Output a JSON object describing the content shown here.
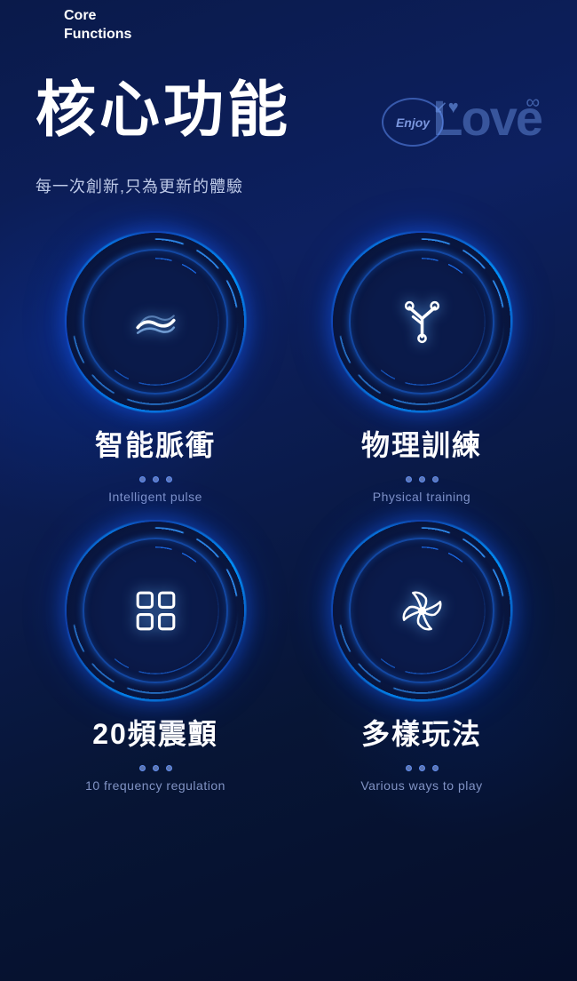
{
  "header": {
    "core_label": "Core",
    "functions_label": "Functions"
  },
  "hero": {
    "main_title": "核心功能",
    "subtitle": "每一次創新,只為更新的體驗",
    "enjoy_love": {
      "enjoy": "Enjoy",
      "love": "Love",
      "infinity": "∞"
    }
  },
  "features": [
    {
      "id": "intelligent-pulse",
      "name_zh": "智能脈衝",
      "name_en": "Intelligent pulse",
      "icon": "pulse",
      "dots": 3
    },
    {
      "id": "physical-training",
      "name_zh": "物理訓練",
      "name_en": "Physical training",
      "icon": "training",
      "dots": 3
    },
    {
      "id": "frequency",
      "name_zh": "20頻震顫",
      "name_en": "10 frequency regulation",
      "icon": "grid",
      "dots": 3
    },
    {
      "id": "various-play",
      "name_zh": "多樣玩法",
      "name_en": "Various ways to play",
      "icon": "fan",
      "dots": 3
    }
  ]
}
